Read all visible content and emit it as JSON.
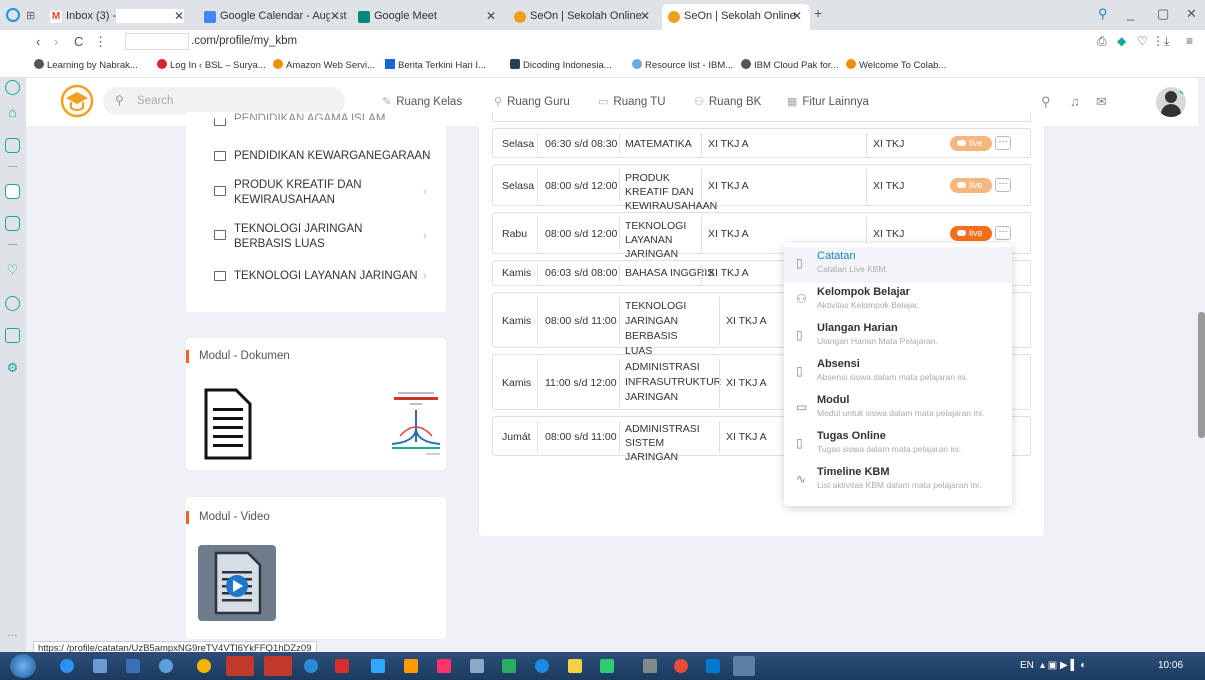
{
  "browser": {
    "tabs": [
      {
        "label": "Inbox (3) -",
        "color": "#ea4335"
      },
      {
        "label": "Google Calendar - August",
        "color": "#4285f4"
      },
      {
        "label": "Google Meet",
        "color": "#00897b"
      },
      {
        "label": "SeOn | Sekolah Online",
        "color": "#f0a01e"
      },
      {
        "label": "SeOn | Sekolah Online",
        "color": "#f0a01e"
      }
    ],
    "new_tab": "+",
    "url_path": ".com/profile/my_kbm",
    "bookmarks": [
      {
        "label": "Learning by Nabrak...",
        "color": "#555"
      },
      {
        "label": "Log In ‹ BSL – Surya...",
        "color": "#d9242c"
      },
      {
        "label": "Amazon Web Servi...",
        "color": "#f29100"
      },
      {
        "label": "Berita Terkini Hari I...",
        "color": "#1a66d9"
      },
      {
        "label": "Dicoding Indonesia...",
        "color": "#2d3e50"
      },
      {
        "label": "Resource list - IBM...",
        "color": "#6fa8dc"
      },
      {
        "label": "IBM Cloud Pak for...",
        "color": "#555"
      },
      {
        "label": "Welcome To Colab...",
        "color": "#f29100"
      }
    ]
  },
  "header": {
    "search_placeholder": "Search",
    "nav": [
      {
        "label": "Ruang Kelas",
        "icon": "✎"
      },
      {
        "label": "Ruang Guru",
        "icon": "⚲"
      },
      {
        "label": "Ruang TU",
        "icon": "▭"
      },
      {
        "label": "Ruang BK",
        "icon": "⚇"
      },
      {
        "label": "Fitur Lainnya",
        "icon": "▦"
      }
    ]
  },
  "subjects": [
    {
      "label": "PENDIDIKAN AGAMA ISLAM"
    },
    {
      "label": "PENDIDIKAN KEWARGANEGARAAN"
    },
    {
      "label": "PRODUK KREATIF DAN KEWIRAUSAHAAN"
    },
    {
      "label": "TEKNOLOGI JARINGAN BERBASIS LUAS"
    },
    {
      "label": "TEKNOLOGI LAYANAN JARINGAN"
    }
  ],
  "modul_dokumen": {
    "title": "Modul - Dokumen"
  },
  "modul_video": {
    "title": "Modul - Video"
  },
  "schedule": [
    {
      "day": "Selasa",
      "time": "06:30 s/d 08:30",
      "subject": "MATEMATIKA",
      "class": "XI TKJ A",
      "major": "XI TKJ",
      "live": "live"
    },
    {
      "day": "Selasa",
      "time": "08:00 s/d 12:00",
      "subject": "PRODUK KREATIF DAN KEWIRAUSAHAAN",
      "class": "XI TKJ A",
      "major": "XI TKJ",
      "live": "live"
    },
    {
      "day": "Rabu",
      "time": "08:00 s/d 12:00",
      "subject": "TEKNOLOGI LAYANAN JARINGAN",
      "class": "XI TKJ A",
      "major": "XI TKJ",
      "live": "live"
    },
    {
      "day": "Kamis",
      "time": "06:03 s/d 08:00",
      "subject": "BAHASA INGGRIS",
      "class": "XI TKJ A"
    },
    {
      "day": "Kamis",
      "time": "08:00 s/d 11:00",
      "subject": "TEKNOLOGI JARINGAN BERBASIS LUAS",
      "class": "XI TKJ A"
    },
    {
      "day": "Kamis",
      "time": "11:00 s/d 12:00",
      "subject": "ADMINISTRASI INFRASUTRUKTUR JARINGAN",
      "class": "XI TKJ A"
    },
    {
      "day": "Jumát",
      "time": "08:00 s/d 11:00",
      "subject": "ADMINISTRASI SISTEM JARINGAN",
      "class": "XI TKJ A"
    }
  ],
  "more_label": "···",
  "dropdown": [
    {
      "title": "Catatan",
      "desc": "Catatan Live KBM.",
      "icon": "clipboard-icon",
      "glyph": "▯"
    },
    {
      "title": "Kelompok Belajar",
      "desc": "Aktivitas Kelompok Belajar.",
      "icon": "users-icon",
      "glyph": "⚇"
    },
    {
      "title": "Ulangan Harian",
      "desc": "Ulangan Harian Mata Pelajaran.",
      "icon": "clipboard-icon",
      "glyph": "▯"
    },
    {
      "title": "Absensi",
      "desc": "Absensi siswa dalam mata pelajaran ini.",
      "icon": "clipboard-icon",
      "glyph": "▯"
    },
    {
      "title": "Modul",
      "desc": "Modul untuk siswa dalam mata pelajaran ini.",
      "icon": "book-icon",
      "glyph": "▭"
    },
    {
      "title": "Tugas Online",
      "desc": "Tugas siswa dalam mata pelajaran ini.",
      "icon": "clipboard-icon",
      "glyph": "▯"
    },
    {
      "title": "Timeline KBM",
      "desc": "List aktivitas KBM dalam mata pelajaran ini.",
      "icon": "activity-icon",
      "glyph": "∿"
    }
  ],
  "status_url": "https:/                /profile/catatan/UzB5ampxNG9reTV4VTl6YkFFQ1hDZz09",
  "tray": {
    "lang": "EN",
    "time": "10:06"
  },
  "colors": {
    "accent": "#f36f1d",
    "link": "#1a7fc9",
    "teal": "#1aa6a0"
  }
}
